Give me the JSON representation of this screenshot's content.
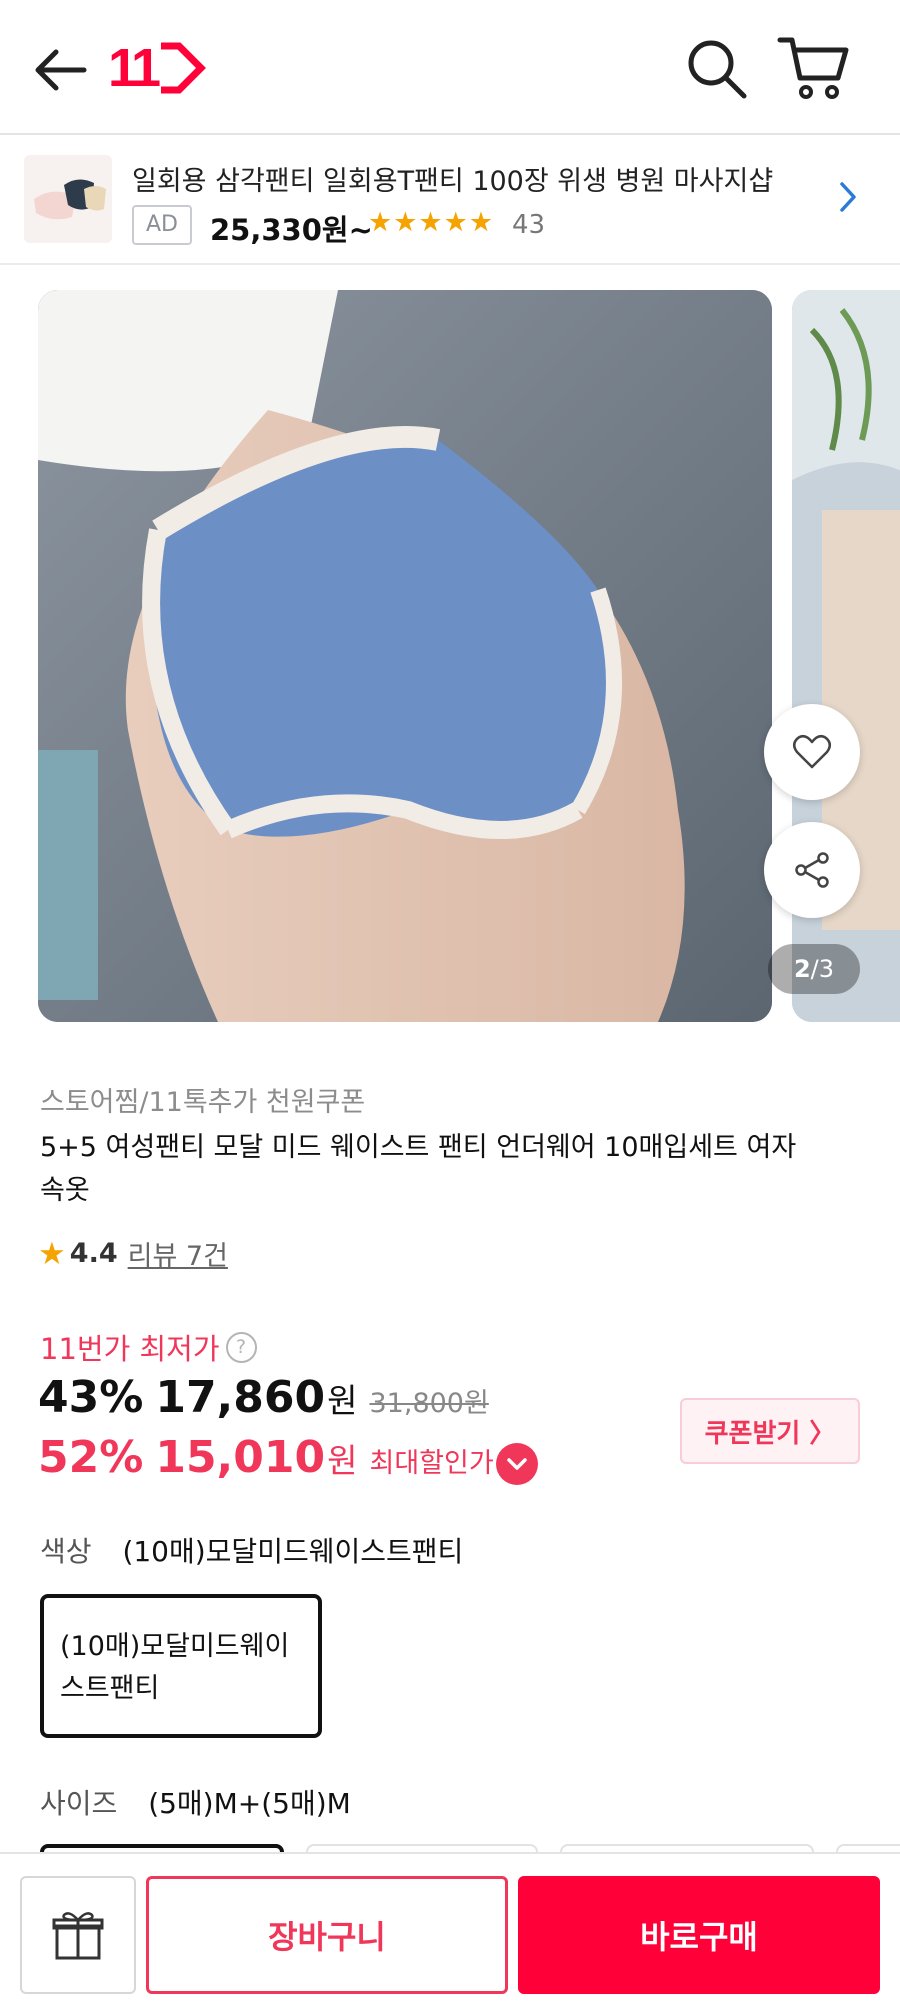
{
  "header": {
    "logo_text": "11",
    "back_icon": "arrow-left-icon",
    "search_icon": "search-icon",
    "cart_icon": "cart-icon"
  },
  "ad": {
    "title": "일회용 삼각팬티 일회용T팬티 100장 위생 병원 마사지샵",
    "badge": "AD",
    "price": "25,330원~",
    "stars": "★★★★★",
    "review_count": "43"
  },
  "gallery": {
    "current": "2",
    "total": "/3"
  },
  "product": {
    "store_line": "스토어찜/11톡추가 천원쿠폰",
    "title": "5+5 여성팬티 모달 미드 웨이스트 팬티 언더웨어 10매입세트 여자속옷",
    "rating_score": "4.4",
    "review_link": "리뷰 7건"
  },
  "price": {
    "lowest_label": "11번가 최저가",
    "help_mark": "?",
    "discount1": "43%",
    "price1": "17,860",
    "won": "원",
    "original": "31,800원",
    "discount2": "52%",
    "price2": "15,010",
    "max_label": "최대할인가",
    "coupon_button": "쿠폰받기 〉"
  },
  "options": {
    "color_label": "색상",
    "color_value": "(10매)모달미드웨이스트팬티",
    "color_option": "(10매)모달미드웨이스트팬티",
    "size_label": "사이즈",
    "size_value": "(5매)M+(5매)M"
  },
  "bottom_bar": {
    "gift_icon": "gift-icon",
    "cart_button": "장바구니",
    "buy_button": "바로구매"
  },
  "colors": {
    "brand": "#ff0038",
    "accent_pink": "#f0375a",
    "star": "#f5a300"
  }
}
